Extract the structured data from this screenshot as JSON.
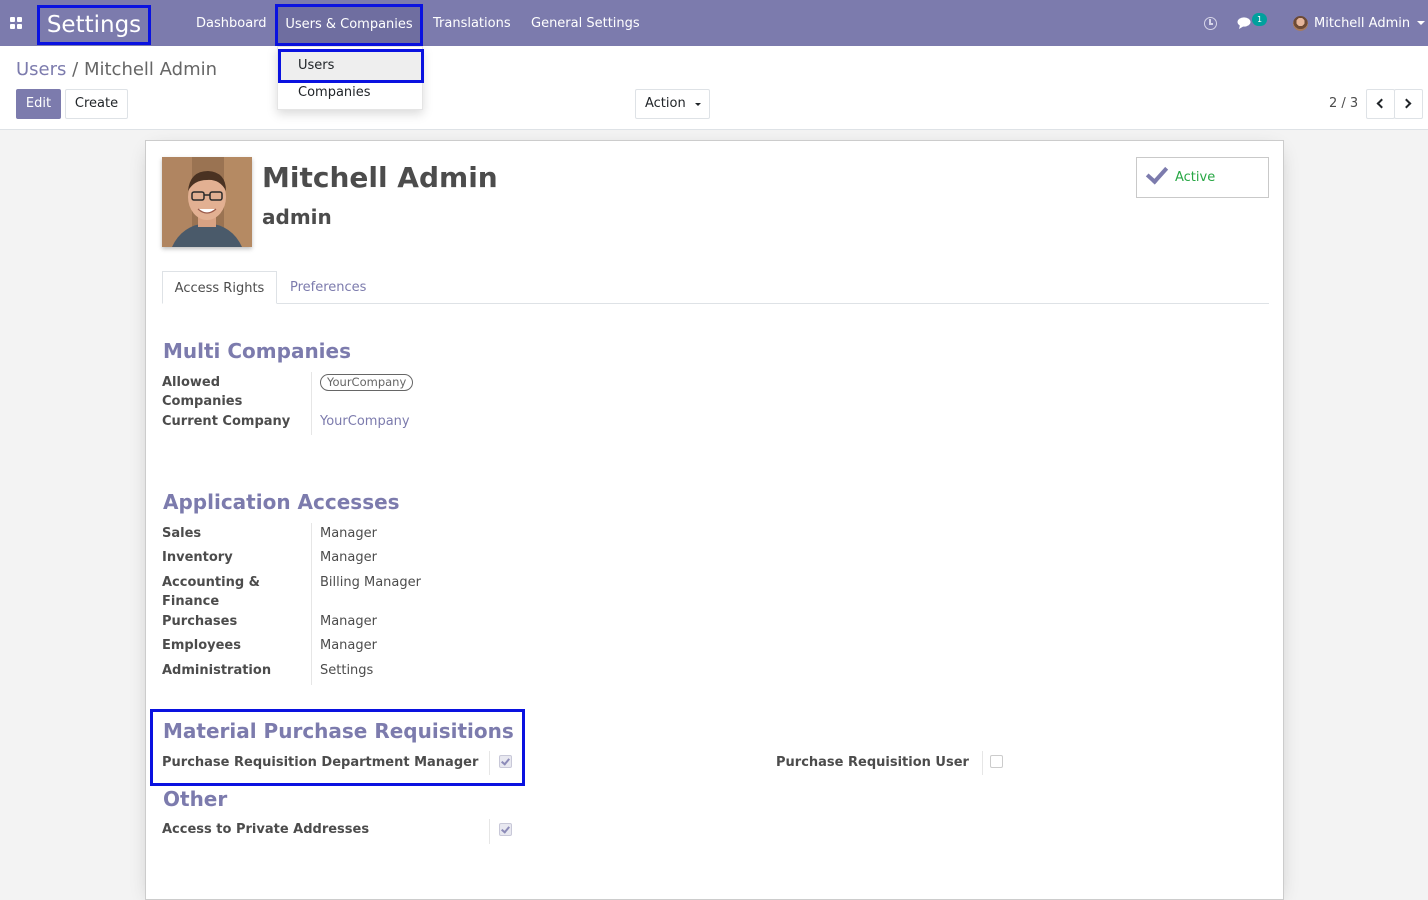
{
  "navbar": {
    "app_title": "Settings",
    "menu": [
      "Dashboard",
      "Users & Companies",
      "Translations",
      "General Settings"
    ],
    "chat_count": "1",
    "user_name": "Mitchell Admin"
  },
  "dropdown": {
    "items": [
      "Users",
      "Companies"
    ]
  },
  "control_panel": {
    "breadcrumb_parent": "Users",
    "breadcrumb_separator": "/",
    "breadcrumb_current": "Mitchell Admin",
    "edit_label": "Edit",
    "create_label": "Create",
    "action_label": "Action",
    "pager": "2 / 3"
  },
  "record": {
    "name": "Mitchell Admin",
    "login": "admin",
    "active_label": "Active"
  },
  "tabs": [
    "Access Rights",
    "Preferences"
  ],
  "multi_companies": {
    "title": "Multi Companies",
    "allowed_label": "Allowed Companies",
    "allowed_value": "YourCompany",
    "current_label": "Current Company",
    "current_value": "YourCompany"
  },
  "application_accesses": {
    "title": "Application Accesses",
    "rows": [
      {
        "label": "Sales",
        "value": "Manager"
      },
      {
        "label": "Inventory",
        "value": "Manager"
      },
      {
        "label": "Accounting & Finance",
        "value": "Billing Manager"
      },
      {
        "label": "Purchases",
        "value": "Manager"
      },
      {
        "label": "Employees",
        "value": "Manager"
      },
      {
        "label": "Administration",
        "value": "Settings"
      }
    ]
  },
  "material_purchase": {
    "title": "Material Purchase Requisitions",
    "dept_manager_label": "Purchase Requisition Department Manager",
    "dept_manager_checked": true,
    "user_label": "Purchase Requisition User",
    "user_checked": false
  },
  "other": {
    "title": "Other",
    "private_addresses_label": "Access to Private Addresses",
    "private_addresses_checked": true
  },
  "colors": {
    "brand": "#7c7bad",
    "highlight": "#0a12e0",
    "active_green": "#28a745"
  }
}
